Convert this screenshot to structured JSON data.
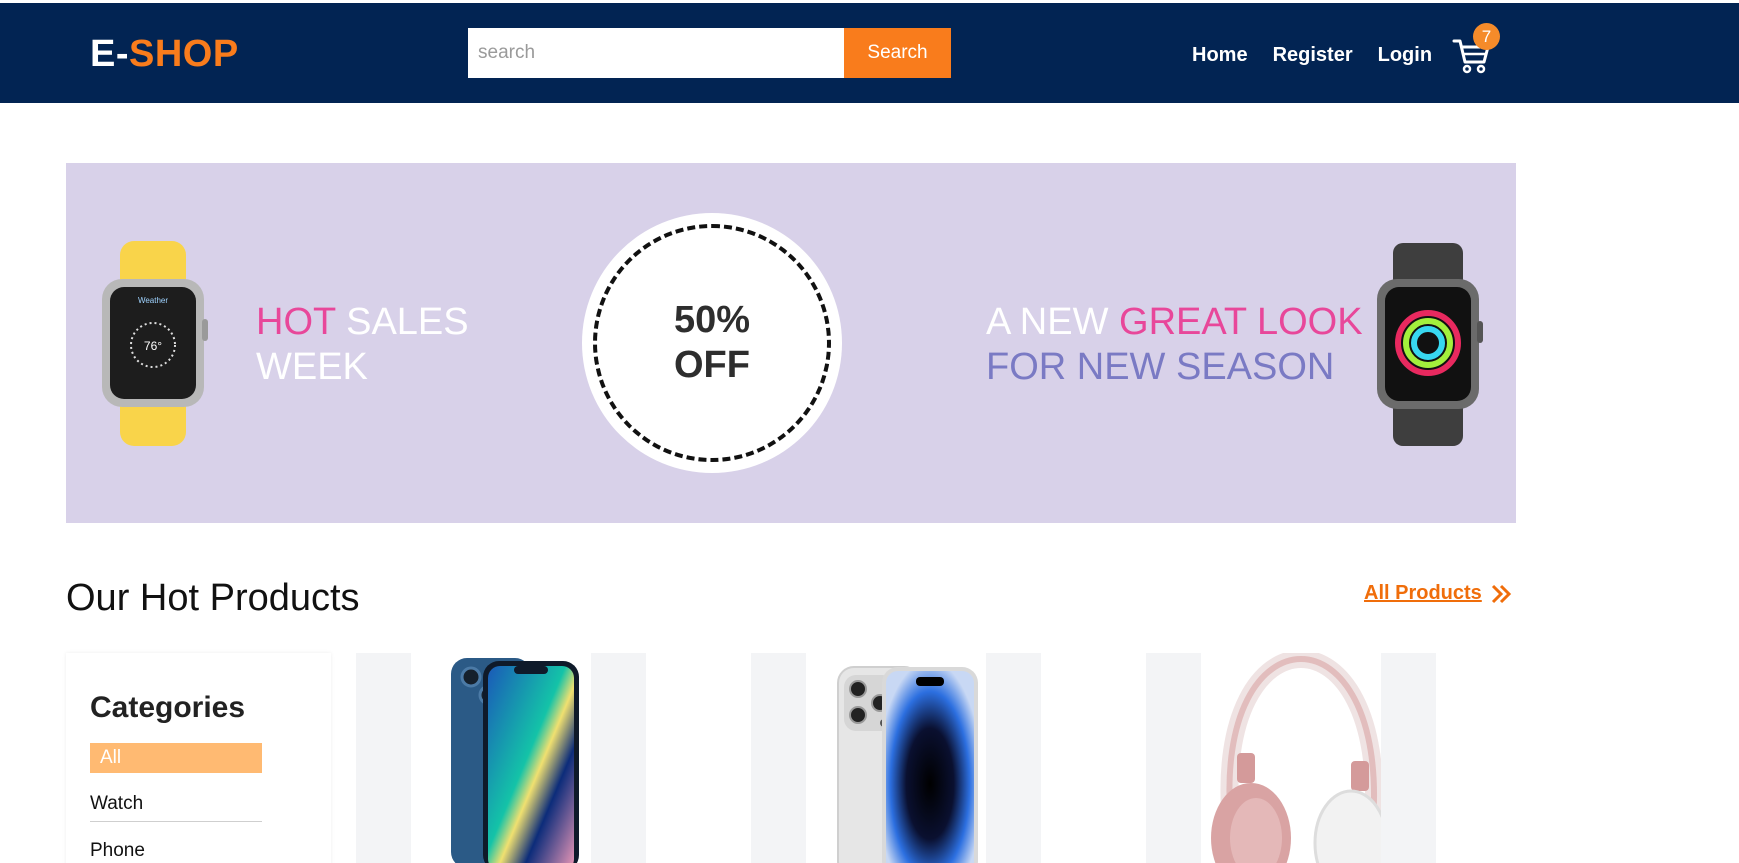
{
  "header": {
    "logo_prefix": "E-",
    "logo_main": "SHOP",
    "search_placeholder": "search",
    "search_button": "Search",
    "nav": [
      "Home",
      "Register",
      "Login"
    ],
    "cart_count": "7"
  },
  "banner": {
    "left_text_pink": "HOT",
    "left_text_white_1": "SALES",
    "left_text_white_2": "WEEK",
    "discount_line1": "50%",
    "discount_line2": "OFF",
    "right_text_white": "A NEW",
    "right_text_pink": "GREAT LOOK",
    "right_text_purple": "FOR NEW SEASON"
  },
  "section": {
    "title": "Our Hot Products",
    "all_products": "All Products"
  },
  "categories": {
    "title": "Categories",
    "items": [
      "All",
      "Watch",
      "Phone"
    ]
  },
  "products": [
    {
      "icon": "iphone-13-blue"
    },
    {
      "icon": "iphone-14-pro-silver"
    },
    {
      "icon": "headphones-rose-gold"
    }
  ],
  "colors": {
    "navbar": "#022453",
    "accent": "#f97c1c",
    "banner_bg": "#d8d1e9",
    "pink": "#e8479a",
    "purple": "#7a7ac4"
  }
}
